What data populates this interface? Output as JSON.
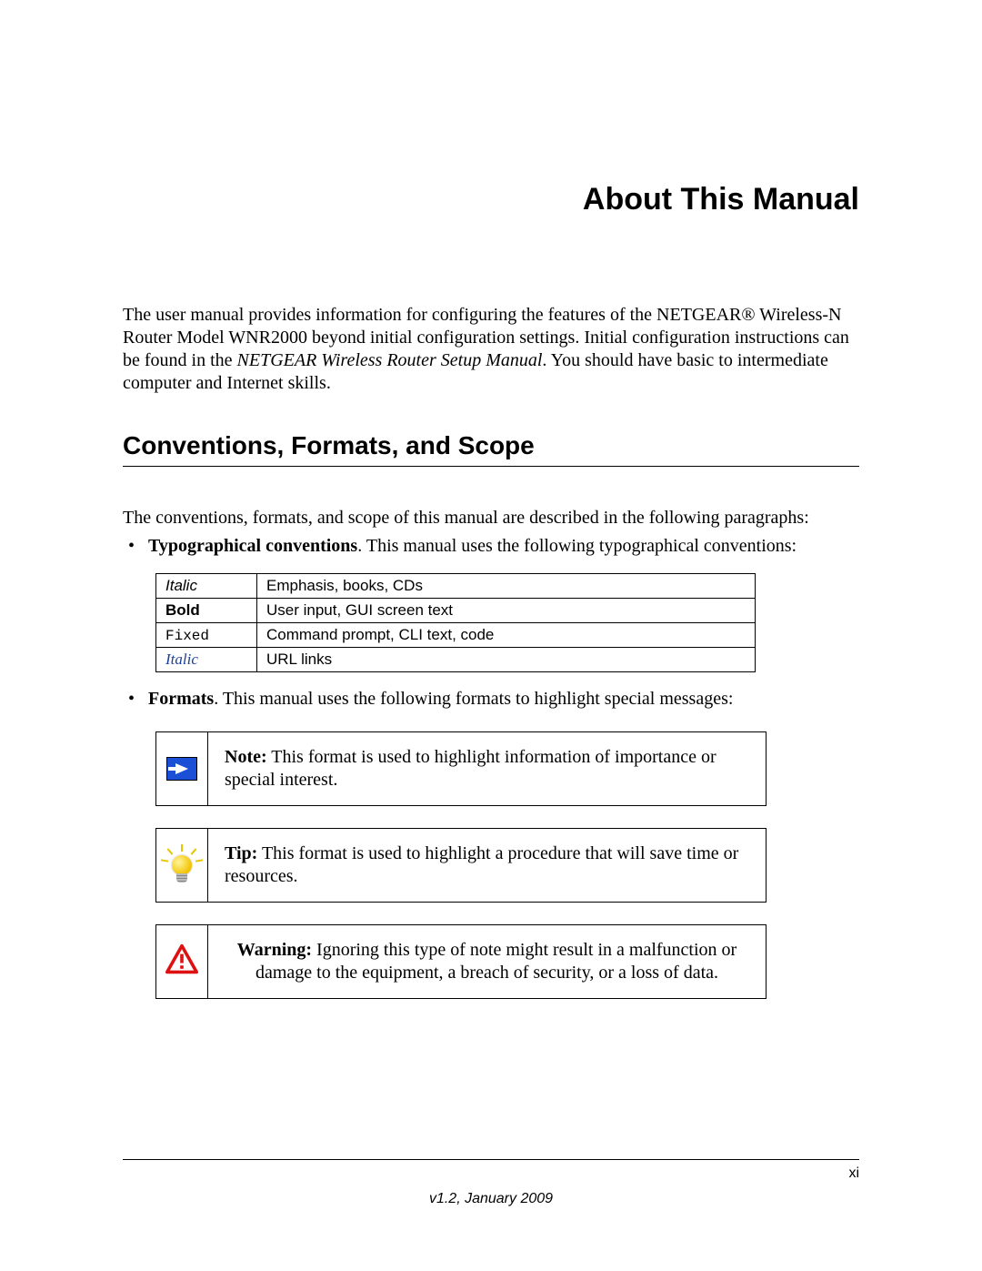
{
  "chapter": {
    "title": "About This Manual"
  },
  "intro": {
    "part1": "The user manual provides information for configuring the features of the NETGEAR® Wireless-N Router Model WNR2000  beyond initial configuration settings. Initial configuration instructions can be found in the ",
    "ref": "NETGEAR Wireless Router Setup Manual",
    "part2": ". You should have basic to intermediate computer and Internet skills."
  },
  "section": {
    "heading": "Conventions, Formats, and Scope",
    "intro": "The conventions, formats, and scope of this manual are described in the following paragraphs:"
  },
  "bullets": {
    "typographical": {
      "lead": "Typographical conventions",
      "rest": ". This manual uses the following typographical conventions:"
    },
    "formats": {
      "lead": "Formats",
      "rest": ". This manual uses the following formats to highlight special messages:"
    }
  },
  "conventions_table": {
    "rows": [
      {
        "style": "italic",
        "label": "Italic",
        "desc": "Emphasis, books, CDs"
      },
      {
        "style": "bold",
        "label": "Bold",
        "desc": "User input, GUI screen text"
      },
      {
        "style": "fixed",
        "label": "Fixed",
        "desc": "Command prompt, CLI text, code"
      },
      {
        "style": "italic-link",
        "label": "Italic",
        "desc": "URL links"
      }
    ]
  },
  "callouts": {
    "note": {
      "label": "Note:",
      "text": " This format is used to highlight information of importance or special interest."
    },
    "tip": {
      "label": "Tip:",
      "text": " This format is used to highlight a procedure that will save time or resources."
    },
    "warning": {
      "label": "Warning:",
      "text": " Ignoring this type of note might result in a malfunction or damage to the equipment, a breach of security, or a loss of data."
    }
  },
  "footer": {
    "page_number": "xi",
    "version": "v1.2, January 2009"
  }
}
